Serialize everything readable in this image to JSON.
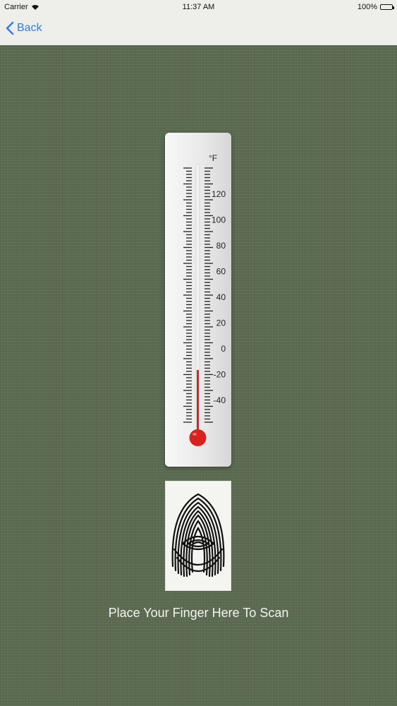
{
  "status_bar": {
    "carrier": "Carrier",
    "time": "11:37 AM",
    "battery": "100%",
    "wifi_icon": "wifi-icon",
    "battery_icon": "battery-icon"
  },
  "nav": {
    "back_label": "Back",
    "back_icon": "chevron-left-icon",
    "accent_color": "#2b7cf6"
  },
  "thermometer": {
    "unit": "°F",
    "tick_labels": [
      "120",
      "100",
      "80",
      "60",
      "40",
      "20",
      "0",
      "-20",
      "-40"
    ],
    "mercury_color": "#d6231e"
  },
  "fingerprint": {
    "icon": "fingerprint-icon"
  },
  "scan_label": "Place Your Finger Here To Scan"
}
